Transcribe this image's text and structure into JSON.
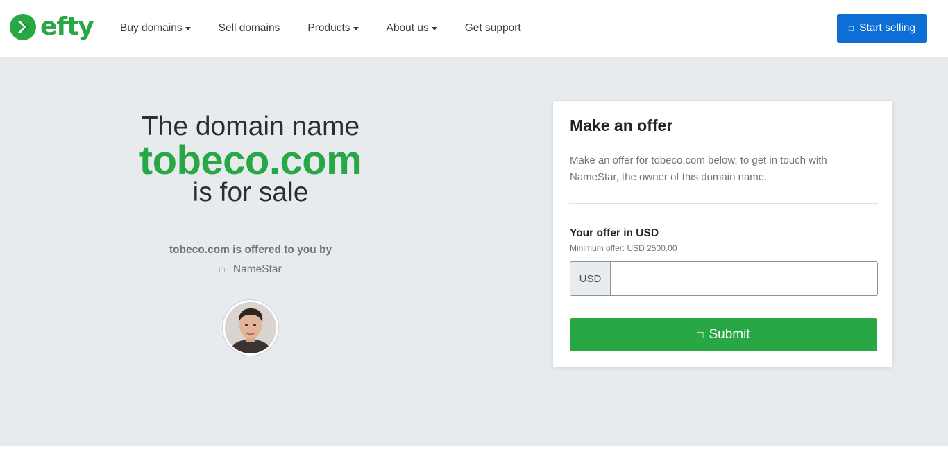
{
  "brand": {
    "name": "efty"
  },
  "nav": {
    "items": [
      {
        "label": "Buy domains",
        "dropdown": true
      },
      {
        "label": "Sell domains",
        "dropdown": false
      },
      {
        "label": "Products",
        "dropdown": true
      },
      {
        "label": "About us",
        "dropdown": true
      },
      {
        "label": "Get support",
        "dropdown": false
      }
    ],
    "cta": {
      "label": "Start selling",
      "icon": "user-plus-icon"
    }
  },
  "hero": {
    "lead1": "The domain name",
    "domain": "tobeco.com",
    "lead2": "is for sale",
    "offered_by": "tobeco.com is offered to you by",
    "seller_name": "NameStar",
    "seller_icon": "user-icon"
  },
  "offer_card": {
    "title": "Make an offer",
    "description": "Make an offer for tobeco.com below, to get in touch with NameStar, the owner of this domain name.",
    "offer_label": "Your offer in USD",
    "minimum": "Minimum offer: USD 2500.00",
    "currency": "USD",
    "amount_value": "",
    "amount_placeholder": "",
    "submit_label": "Submit",
    "submit_icon": "send-icon"
  },
  "colors": {
    "brand_green": "#28a745",
    "primary_blue": "#0d6fd6",
    "hero_bg": "#e8ebee"
  }
}
